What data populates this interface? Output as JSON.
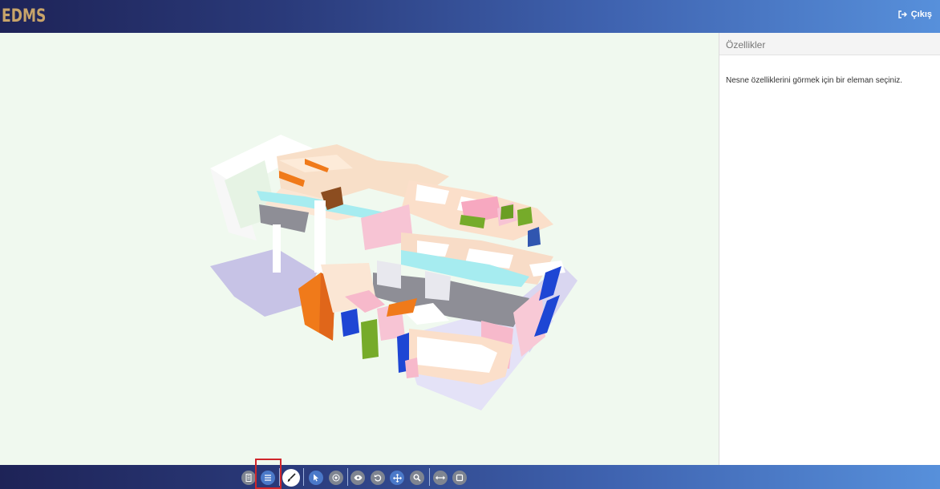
{
  "header": {
    "brand": "EDMS",
    "logout_label": "Çıkış"
  },
  "properties_panel": {
    "title": "Özellikler",
    "message": "Nesne özelliklerini görmek için bir eleman seçiniz."
  },
  "toolbar": {
    "buttons": [
      {
        "icon": "building-icon"
      },
      {
        "icon": "list-icon",
        "selected": true
      },
      {
        "icon": "brush-icon"
      },
      {
        "icon": "pointer-icon"
      },
      {
        "icon": "target-icon"
      },
      {
        "icon": "eye-icon"
      },
      {
        "icon": "rotate-icon"
      },
      {
        "icon": "pan-icon"
      },
      {
        "icon": "zoom-icon"
      },
      {
        "icon": "measure-icon"
      },
      {
        "icon": "section-box-icon"
      }
    ]
  },
  "colors": {
    "header_dark": "#1e2357",
    "header_light": "#5790db",
    "brand": "#c8a46a",
    "viewer_bg": "#f0f9ef",
    "highlight": "#d0262b"
  }
}
